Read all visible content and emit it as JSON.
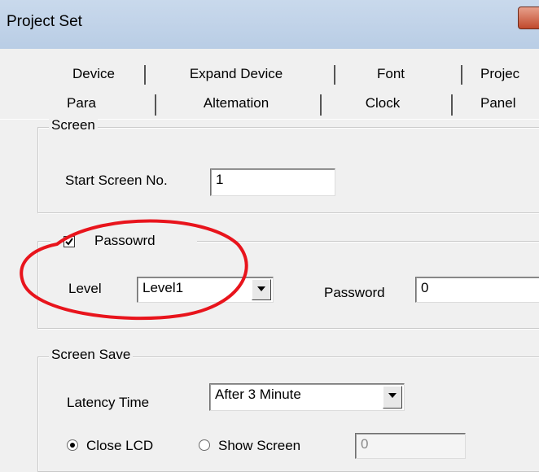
{
  "window": {
    "title": "Project Set"
  },
  "tabs": {
    "row1": [
      "Device",
      "Expand Device",
      "Font",
      "Projec"
    ],
    "row2": [
      "Para",
      "Altemation",
      "Clock",
      "Panel"
    ]
  },
  "screen_group": {
    "legend": "Screen",
    "start_screen_label": "Start Screen No.",
    "start_screen_value": "1"
  },
  "password_group": {
    "legend": "Passowrd",
    "checked": true,
    "level_label": "Level",
    "level_value": "Level1",
    "password_label": "Password",
    "password_value": "0"
  },
  "screen_save_group": {
    "legend": "Screen Save",
    "latency_label": "Latency Time",
    "latency_value": "After 3 Minute",
    "close_lcd_label": "Close LCD",
    "show_screen_label": "Show Screen",
    "show_screen_value": "0",
    "selected": "close_lcd"
  },
  "colors": {
    "annotation": "#e8141c"
  }
}
